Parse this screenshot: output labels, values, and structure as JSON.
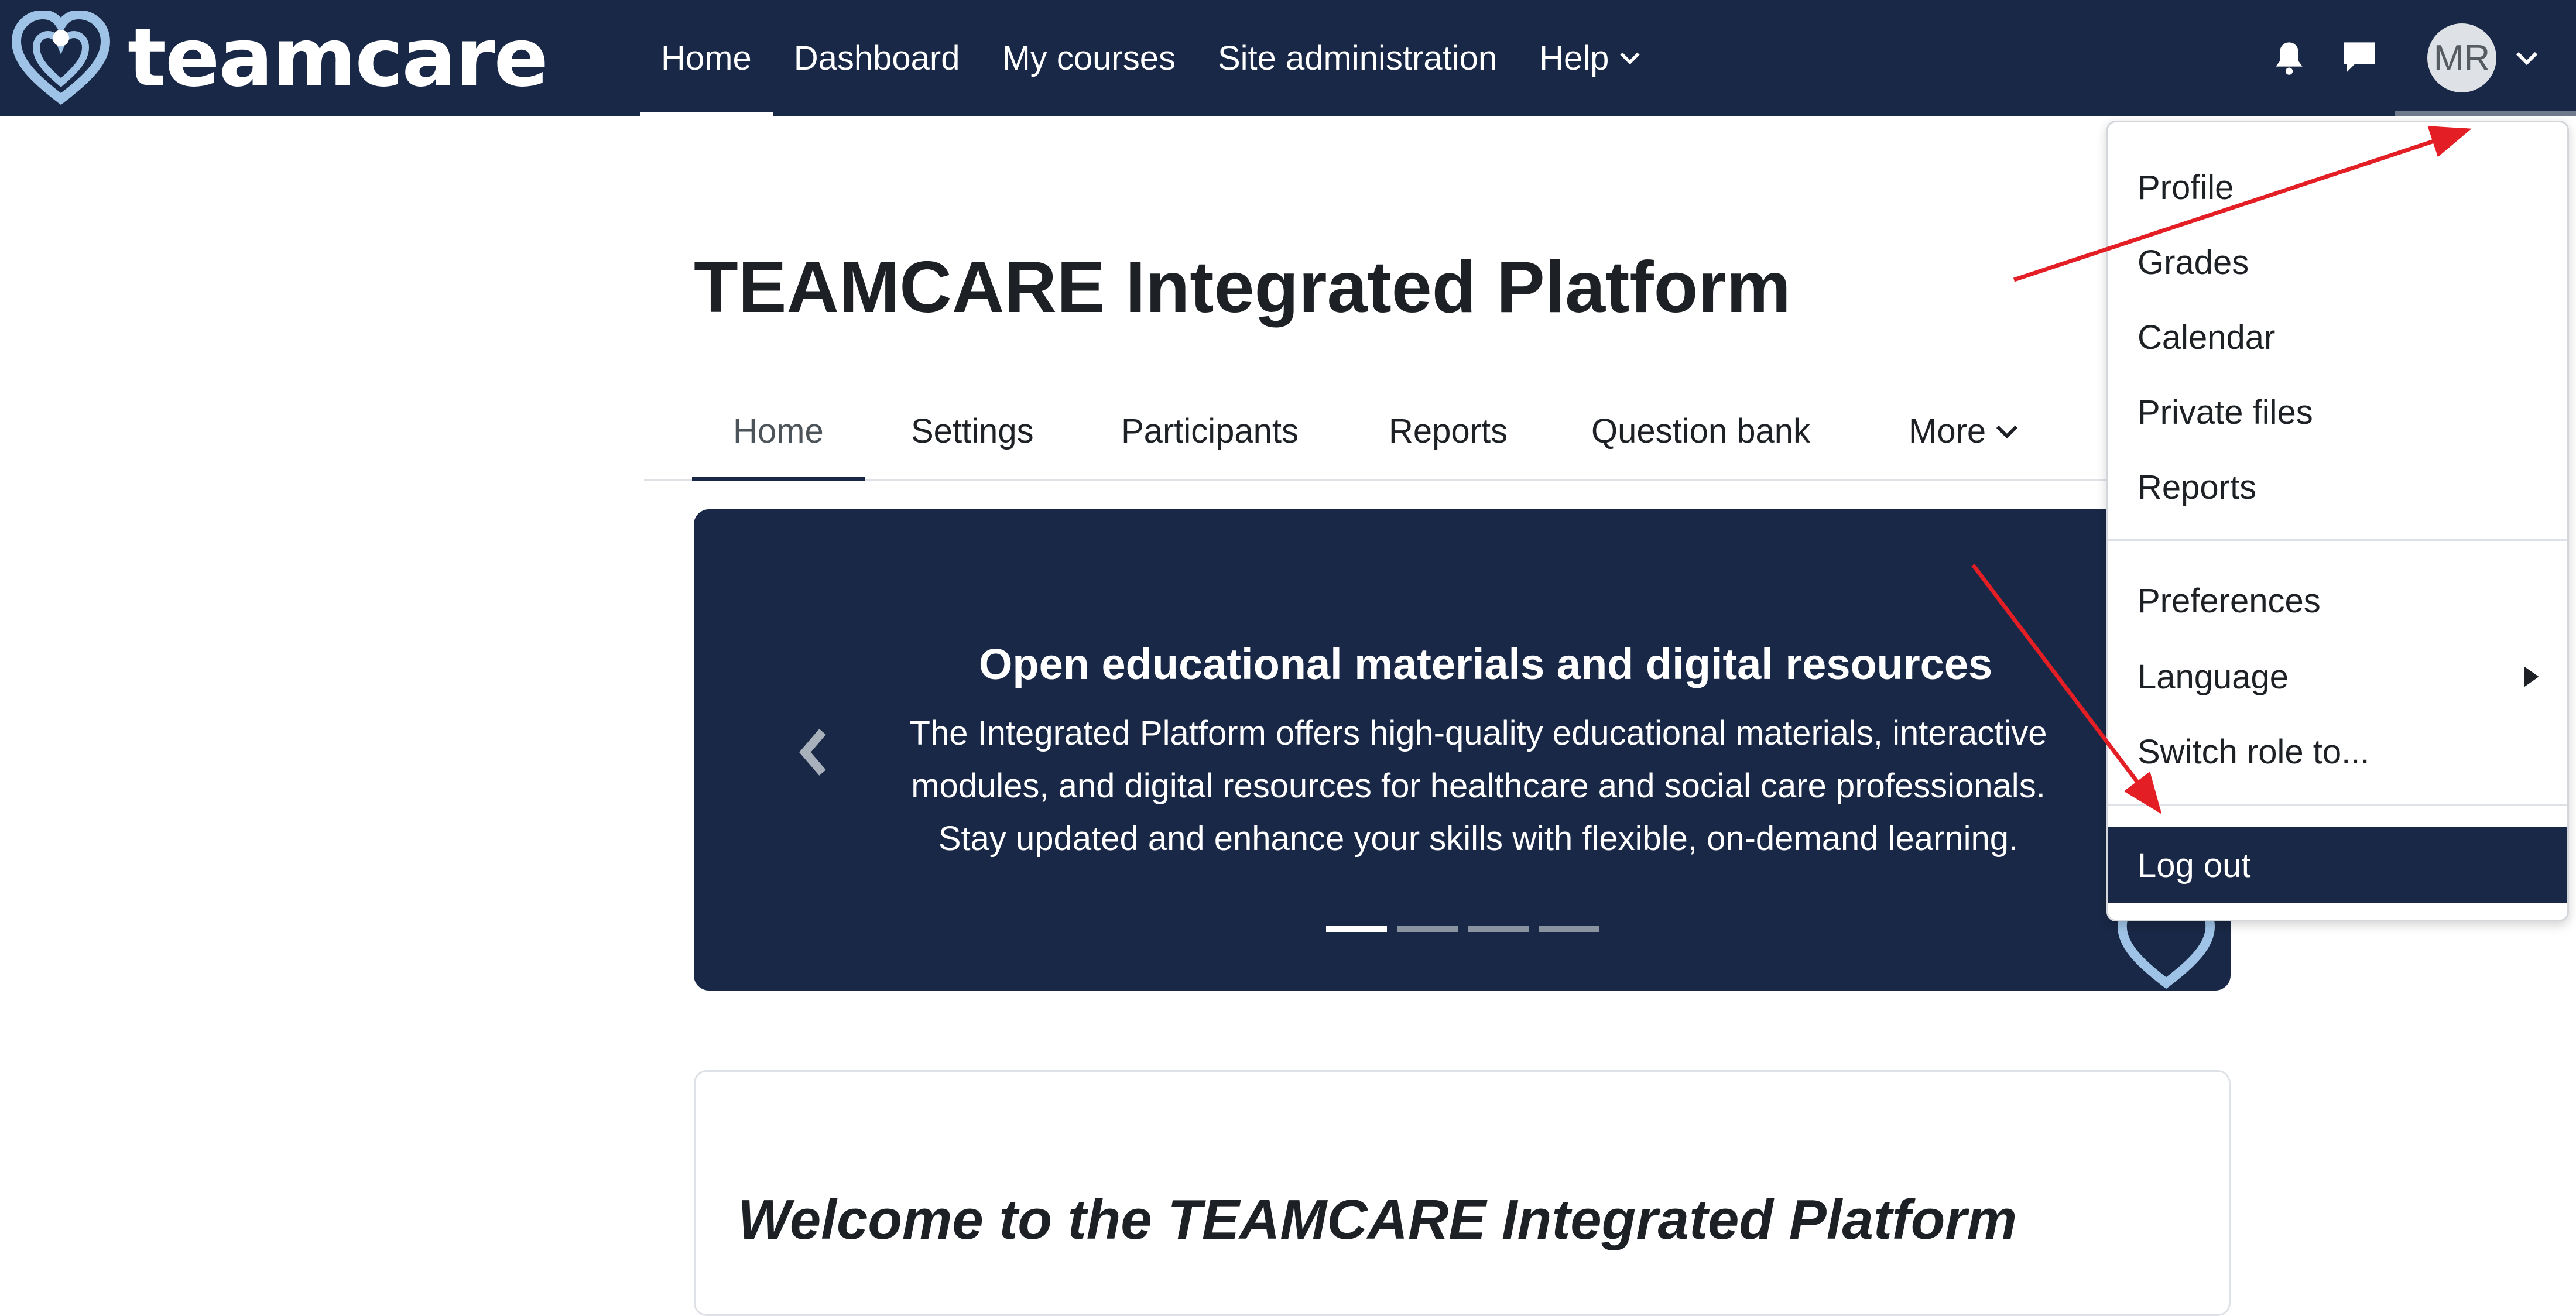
{
  "brand": {
    "name": "teamcare",
    "logo_icon": "heart-logo-icon"
  },
  "navbar": {
    "items": [
      {
        "label": "Home",
        "active": true
      },
      {
        "label": "Dashboard"
      },
      {
        "label": "My courses"
      },
      {
        "label": "Site administration"
      },
      {
        "label": "Help"
      }
    ],
    "notifications_icon": "bell-icon",
    "messages_icon": "chat-bubble-icon",
    "user_initials": "MR"
  },
  "page": {
    "title": "TEAMCARE Integrated Platform"
  },
  "secondary_nav": {
    "items": [
      {
        "label": "Home",
        "active": true
      },
      {
        "label": "Settings"
      },
      {
        "label": "Participants"
      },
      {
        "label": "Reports"
      },
      {
        "label": "Question bank"
      },
      {
        "label": "More"
      }
    ]
  },
  "carousel": {
    "title": "Open educational materials and digital resources",
    "text": "The Integrated Platform offers high-quality educational materials, interactive modules, and digital resources for healthcare and social care professionals. Stay updated and enhance your skills with flexible, on-demand learning.",
    "slides_count": 4,
    "active_slide": 1
  },
  "welcome": {
    "prefix": "Welcome to the ",
    "emphasis": "TEAMCARE Integrated Platform"
  },
  "user_menu": {
    "items": [
      {
        "label": "Profile"
      },
      {
        "label": "Grades"
      },
      {
        "label": "Calendar"
      },
      {
        "label": "Private files"
      },
      {
        "label": "Reports"
      },
      {
        "label": "Preferences"
      },
      {
        "label": "Language",
        "has_submenu": true
      },
      {
        "label": "Switch role to..."
      },
      {
        "label": "Log out",
        "highlighted": true
      }
    ]
  },
  "colors": {
    "navbar_bg": "#192846",
    "annotation_arrow": "#e31e24",
    "logo_light_blue": "#9fc3e6"
  }
}
